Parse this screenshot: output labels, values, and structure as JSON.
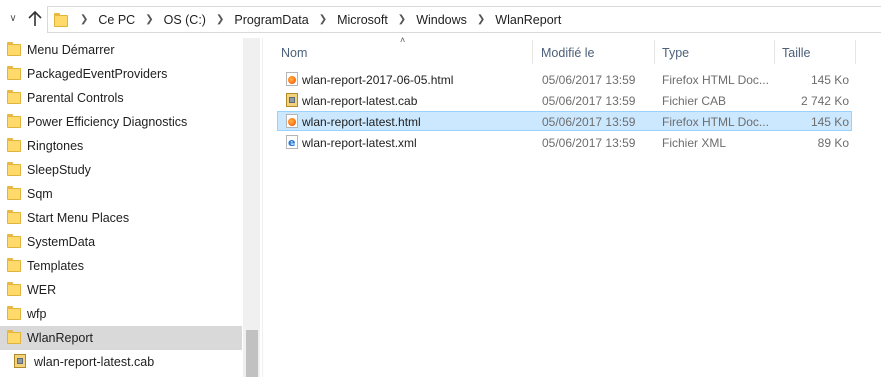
{
  "breadcrumb": [
    {
      "label": "Ce PC"
    },
    {
      "label": "OS (C:)"
    },
    {
      "label": "ProgramData"
    },
    {
      "label": "Microsoft"
    },
    {
      "label": "Windows"
    },
    {
      "label": "WlanReport"
    }
  ],
  "nav_pane": {
    "items": [
      {
        "label": "Menu Démarrer",
        "icon": "folder-icon"
      },
      {
        "label": "PackagedEventProviders",
        "icon": "folder-icon"
      },
      {
        "label": "Parental Controls",
        "icon": "folder-icon"
      },
      {
        "label": "Power Efficiency Diagnostics",
        "icon": "folder-icon"
      },
      {
        "label": "Ringtones",
        "icon": "folder-icon"
      },
      {
        "label": "SleepStudy",
        "icon": "folder-icon"
      },
      {
        "label": "Sqm",
        "icon": "folder-icon"
      },
      {
        "label": "Start Menu Places",
        "icon": "folder-icon"
      },
      {
        "label": "SystemData",
        "icon": "folder-icon"
      },
      {
        "label": "Templates",
        "icon": "folder-icon"
      },
      {
        "label": "WER",
        "icon": "folder-icon"
      },
      {
        "label": "wfp",
        "icon": "folder-icon"
      },
      {
        "label": "WlanReport",
        "icon": "folder-icon",
        "selected": true
      },
      {
        "label": "wlan-report-latest.cab",
        "icon": "cab-file-icon"
      }
    ]
  },
  "columns": {
    "name": "Nom",
    "modified": "Modifié le",
    "type": "Type",
    "size": "Taille"
  },
  "files": [
    {
      "name": "wlan-report-2017-06-05.html",
      "modified": "05/06/2017 13:59",
      "type": "Firefox HTML Doc...",
      "size": "145 Ko",
      "icon": "firefox-html-icon"
    },
    {
      "name": "wlan-report-latest.cab",
      "modified": "05/06/2017 13:59",
      "type": "Fichier CAB",
      "size": "2 742 Ko",
      "icon": "cab-file-icon"
    },
    {
      "name": "wlan-report-latest.html",
      "modified": "05/06/2017 13:59",
      "type": "Firefox HTML Doc...",
      "size": "145 Ko",
      "icon": "firefox-html-icon",
      "selected": true
    },
    {
      "name": "wlan-report-latest.xml",
      "modified": "05/06/2017 13:59",
      "type": "Fichier XML",
      "size": "89 Ko",
      "icon": "xml-file-icon"
    }
  ],
  "colors": {
    "selection_bg": "#cce8ff",
    "selection_border": "#99d1ff",
    "nav_selected_bg": "#d9d9d9",
    "header_text": "#4c607a",
    "folder_yellow": "#ffd96a"
  }
}
